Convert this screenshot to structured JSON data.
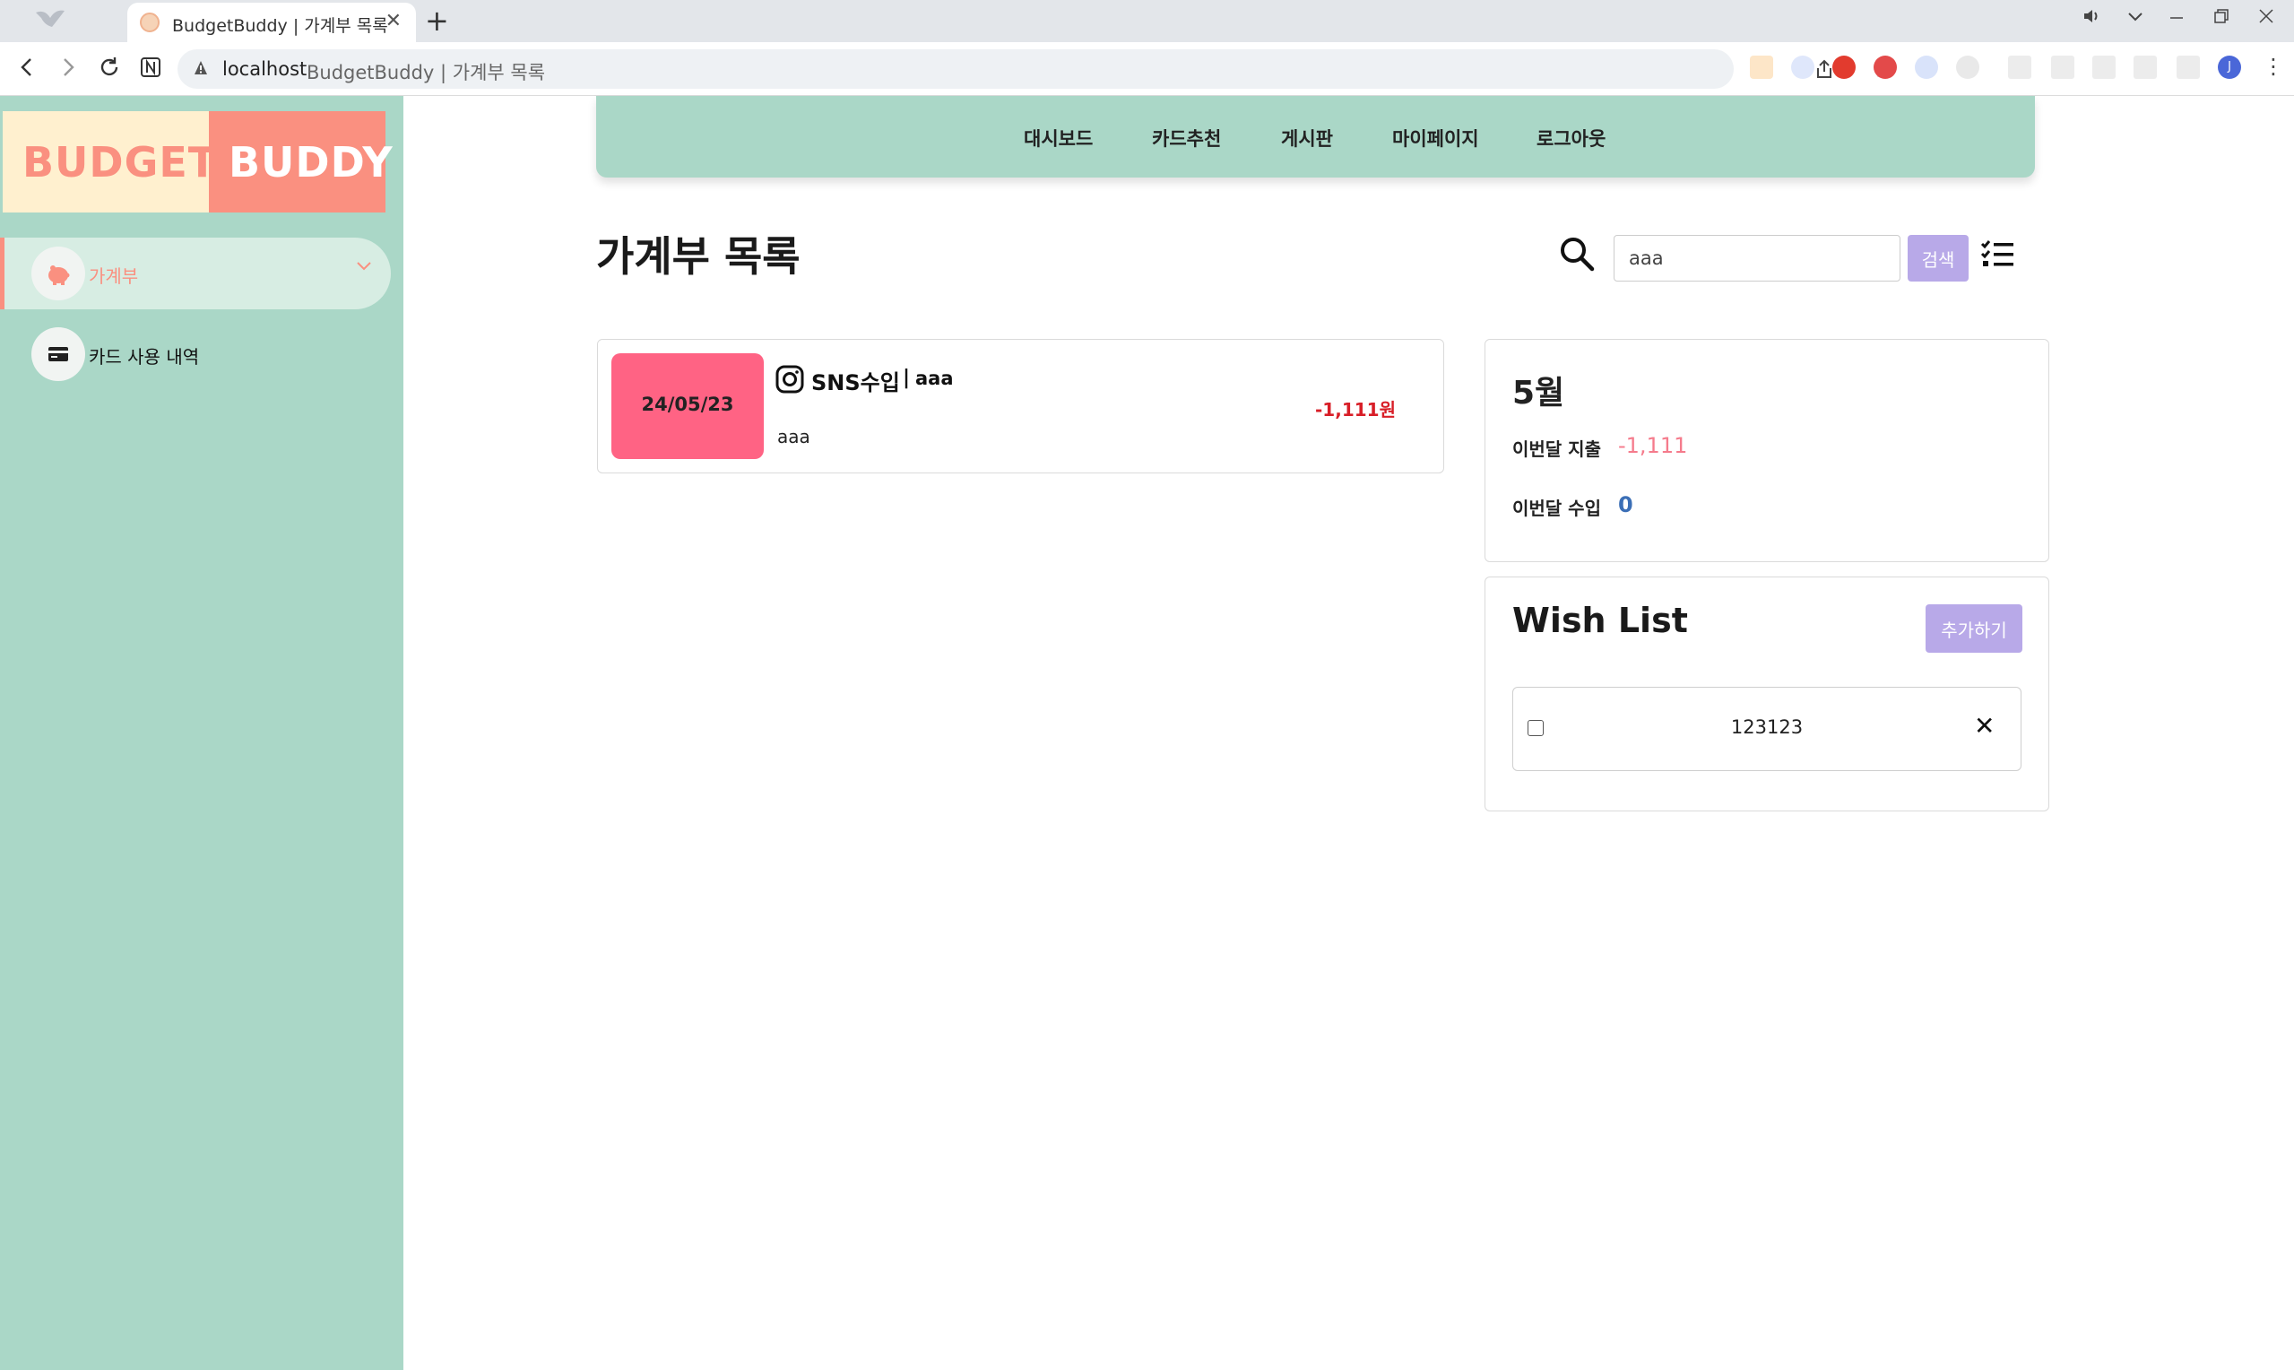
{
  "browser": {
    "tab_title": "BudgetBuddy | 가계부 목록",
    "tab_close": "✕",
    "new_tab": "+",
    "url_host": "localhost",
    "url_path": "BudgetBuddy | 가계부 목록",
    "profile_initial": "J"
  },
  "sidebar": {
    "logo_left": "BUDGET",
    "logo_right": "BUDDY",
    "items": [
      {
        "label": "가계부",
        "icon": "piggy-bank-icon",
        "active": true
      },
      {
        "label": "카드 사용 내역",
        "icon": "credit-card-icon",
        "active": false
      }
    ]
  },
  "topnav": {
    "links": [
      "대시보드",
      "카드추천",
      "게시판",
      "마이페이지",
      "로그아웃"
    ]
  },
  "main": {
    "title": "가계부 목록",
    "search": {
      "value": "aaa",
      "button_label": "검색"
    }
  },
  "entries": [
    {
      "date": "24/05/23",
      "category": "SNS수입",
      "separator": "|",
      "title": "aaa",
      "memo": "aaa",
      "amount": "-1,111원",
      "icon": "instagram-icon"
    }
  ],
  "summary": {
    "month": "5월",
    "expense_label": "이번달 지출",
    "expense_value": "-1,111",
    "income_label": "이번달 수입",
    "income_value": "0"
  },
  "wishlist": {
    "title": "Wish List",
    "add_label": "추가하기",
    "items": [
      {
        "text": "123123",
        "checked": false,
        "delete_label": "✕"
      }
    ]
  },
  "colors": {
    "sidebar_bg": "#aad7c7",
    "accent": "#fa9080",
    "button": "#b8a9e8",
    "date_badge": "#ff6384",
    "expense": "#f57b8c",
    "income": "#3b6fb6",
    "amount": "#d81e27"
  }
}
